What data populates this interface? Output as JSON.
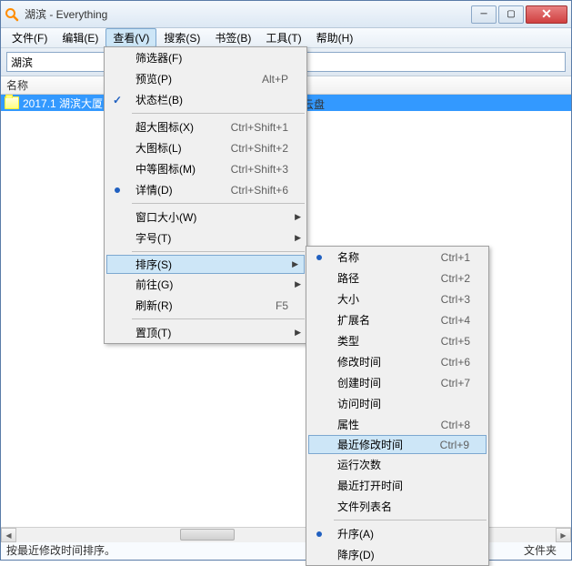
{
  "window_title": "湖滨 - Everything",
  "menubar": [
    "文件(F)",
    "编辑(E)",
    "查看(V)",
    "搜索(S)",
    "书签(B)",
    "工具(T)",
    "帮助(H)"
  ],
  "menubar_active_idx": 2,
  "search_value": "湖滨",
  "column_header": "名称",
  "file_row": "2017.1 湖滨大厦",
  "visible_bg_text": "云盘",
  "statusbar_left": "按最近修改时间排序。",
  "statusbar_right": "文件夹",
  "view_menu": {
    "items": [
      {
        "label": "筛选器(F)",
        "shortcut": "",
        "check": "",
        "arrow": false
      },
      {
        "label": "预览(P)",
        "shortcut": "Alt+P",
        "check": "",
        "arrow": false
      },
      {
        "label": "状态栏(B)",
        "shortcut": "",
        "check": "check",
        "arrow": false
      },
      {
        "sep": true
      },
      {
        "label": "超大图标(X)",
        "shortcut": "Ctrl+Shift+1",
        "check": "",
        "arrow": false
      },
      {
        "label": "大图标(L)",
        "shortcut": "Ctrl+Shift+2",
        "check": "",
        "arrow": false
      },
      {
        "label": "中等图标(M)",
        "shortcut": "Ctrl+Shift+3",
        "check": "",
        "arrow": false
      },
      {
        "label": "详情(D)",
        "shortcut": "Ctrl+Shift+6",
        "check": "radio",
        "arrow": false
      },
      {
        "sep": true
      },
      {
        "label": "窗口大小(W)",
        "shortcut": "",
        "check": "",
        "arrow": true
      },
      {
        "label": "字号(T)",
        "shortcut": "",
        "check": "",
        "arrow": true
      },
      {
        "sep": true
      },
      {
        "label": "排序(S)",
        "shortcut": "",
        "check": "",
        "arrow": true,
        "hover": true
      },
      {
        "label": "前往(G)",
        "shortcut": "",
        "check": "",
        "arrow": true
      },
      {
        "label": "刷新(R)",
        "shortcut": "F5",
        "check": "",
        "arrow": false
      },
      {
        "sep": true
      },
      {
        "label": "置顶(T)",
        "shortcut": "",
        "check": "",
        "arrow": true
      }
    ]
  },
  "sort_menu": {
    "items": [
      {
        "label": "名称",
        "shortcut": "Ctrl+1",
        "check": "radio"
      },
      {
        "label": "路径",
        "shortcut": "Ctrl+2",
        "check": ""
      },
      {
        "label": "大小",
        "shortcut": "Ctrl+3",
        "check": ""
      },
      {
        "label": "扩展名",
        "shortcut": "Ctrl+4",
        "check": ""
      },
      {
        "label": "类型",
        "shortcut": "Ctrl+5",
        "check": ""
      },
      {
        "label": "修改时间",
        "shortcut": "Ctrl+6",
        "check": ""
      },
      {
        "label": "创建时间",
        "shortcut": "Ctrl+7",
        "check": ""
      },
      {
        "label": "访问时间",
        "shortcut": "",
        "check": ""
      },
      {
        "label": "属性",
        "shortcut": "Ctrl+8",
        "check": ""
      },
      {
        "label": "最近修改时间",
        "shortcut": "Ctrl+9",
        "check": "",
        "hover": true
      },
      {
        "label": "运行次数",
        "shortcut": "",
        "check": ""
      },
      {
        "label": "最近打开时间",
        "shortcut": "",
        "check": ""
      },
      {
        "label": "文件列表名",
        "shortcut": "",
        "check": ""
      },
      {
        "sep": true
      },
      {
        "label": "升序(A)",
        "shortcut": "",
        "check": "radio"
      },
      {
        "label": "降序(D)",
        "shortcut": "",
        "check": ""
      }
    ]
  }
}
